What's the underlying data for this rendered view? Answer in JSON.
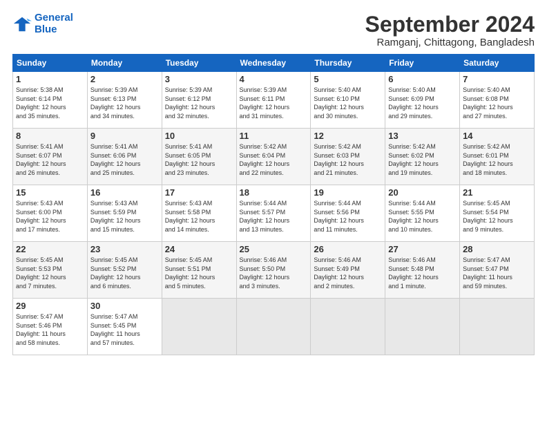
{
  "header": {
    "logo_line1": "General",
    "logo_line2": "Blue",
    "month": "September 2024",
    "location": "Ramganj, Chittagong, Bangladesh"
  },
  "weekdays": [
    "Sunday",
    "Monday",
    "Tuesday",
    "Wednesday",
    "Thursday",
    "Friday",
    "Saturday"
  ],
  "weeks": [
    [
      {
        "day": "1",
        "info": "Sunrise: 5:38 AM\nSunset: 6:14 PM\nDaylight: 12 hours\nand 35 minutes."
      },
      {
        "day": "2",
        "info": "Sunrise: 5:39 AM\nSunset: 6:13 PM\nDaylight: 12 hours\nand 34 minutes."
      },
      {
        "day": "3",
        "info": "Sunrise: 5:39 AM\nSunset: 6:12 PM\nDaylight: 12 hours\nand 32 minutes."
      },
      {
        "day": "4",
        "info": "Sunrise: 5:39 AM\nSunset: 6:11 PM\nDaylight: 12 hours\nand 31 minutes."
      },
      {
        "day": "5",
        "info": "Sunrise: 5:40 AM\nSunset: 6:10 PM\nDaylight: 12 hours\nand 30 minutes."
      },
      {
        "day": "6",
        "info": "Sunrise: 5:40 AM\nSunset: 6:09 PM\nDaylight: 12 hours\nand 29 minutes."
      },
      {
        "day": "7",
        "info": "Sunrise: 5:40 AM\nSunset: 6:08 PM\nDaylight: 12 hours\nand 27 minutes."
      }
    ],
    [
      {
        "day": "8",
        "info": "Sunrise: 5:41 AM\nSunset: 6:07 PM\nDaylight: 12 hours\nand 26 minutes."
      },
      {
        "day": "9",
        "info": "Sunrise: 5:41 AM\nSunset: 6:06 PM\nDaylight: 12 hours\nand 25 minutes."
      },
      {
        "day": "10",
        "info": "Sunrise: 5:41 AM\nSunset: 6:05 PM\nDaylight: 12 hours\nand 23 minutes."
      },
      {
        "day": "11",
        "info": "Sunrise: 5:42 AM\nSunset: 6:04 PM\nDaylight: 12 hours\nand 22 minutes."
      },
      {
        "day": "12",
        "info": "Sunrise: 5:42 AM\nSunset: 6:03 PM\nDaylight: 12 hours\nand 21 minutes."
      },
      {
        "day": "13",
        "info": "Sunrise: 5:42 AM\nSunset: 6:02 PM\nDaylight: 12 hours\nand 19 minutes."
      },
      {
        "day": "14",
        "info": "Sunrise: 5:42 AM\nSunset: 6:01 PM\nDaylight: 12 hours\nand 18 minutes."
      }
    ],
    [
      {
        "day": "15",
        "info": "Sunrise: 5:43 AM\nSunset: 6:00 PM\nDaylight: 12 hours\nand 17 minutes."
      },
      {
        "day": "16",
        "info": "Sunrise: 5:43 AM\nSunset: 5:59 PM\nDaylight: 12 hours\nand 15 minutes."
      },
      {
        "day": "17",
        "info": "Sunrise: 5:43 AM\nSunset: 5:58 PM\nDaylight: 12 hours\nand 14 minutes."
      },
      {
        "day": "18",
        "info": "Sunrise: 5:44 AM\nSunset: 5:57 PM\nDaylight: 12 hours\nand 13 minutes."
      },
      {
        "day": "19",
        "info": "Sunrise: 5:44 AM\nSunset: 5:56 PM\nDaylight: 12 hours\nand 11 minutes."
      },
      {
        "day": "20",
        "info": "Sunrise: 5:44 AM\nSunset: 5:55 PM\nDaylight: 12 hours\nand 10 minutes."
      },
      {
        "day": "21",
        "info": "Sunrise: 5:45 AM\nSunset: 5:54 PM\nDaylight: 12 hours\nand 9 minutes."
      }
    ],
    [
      {
        "day": "22",
        "info": "Sunrise: 5:45 AM\nSunset: 5:53 PM\nDaylight: 12 hours\nand 7 minutes."
      },
      {
        "day": "23",
        "info": "Sunrise: 5:45 AM\nSunset: 5:52 PM\nDaylight: 12 hours\nand 6 minutes."
      },
      {
        "day": "24",
        "info": "Sunrise: 5:45 AM\nSunset: 5:51 PM\nDaylight: 12 hours\nand 5 minutes."
      },
      {
        "day": "25",
        "info": "Sunrise: 5:46 AM\nSunset: 5:50 PM\nDaylight: 12 hours\nand 3 minutes."
      },
      {
        "day": "26",
        "info": "Sunrise: 5:46 AM\nSunset: 5:49 PM\nDaylight: 12 hours\nand 2 minutes."
      },
      {
        "day": "27",
        "info": "Sunrise: 5:46 AM\nSunset: 5:48 PM\nDaylight: 12 hours\nand 1 minute."
      },
      {
        "day": "28",
        "info": "Sunrise: 5:47 AM\nSunset: 5:47 PM\nDaylight: 11 hours\nand 59 minutes."
      }
    ],
    [
      {
        "day": "29",
        "info": "Sunrise: 5:47 AM\nSunset: 5:46 PM\nDaylight: 11 hours\nand 58 minutes."
      },
      {
        "day": "30",
        "info": "Sunrise: 5:47 AM\nSunset: 5:45 PM\nDaylight: 11 hours\nand 57 minutes."
      },
      {
        "day": "",
        "info": ""
      },
      {
        "day": "",
        "info": ""
      },
      {
        "day": "",
        "info": ""
      },
      {
        "day": "",
        "info": ""
      },
      {
        "day": "",
        "info": ""
      }
    ]
  ]
}
